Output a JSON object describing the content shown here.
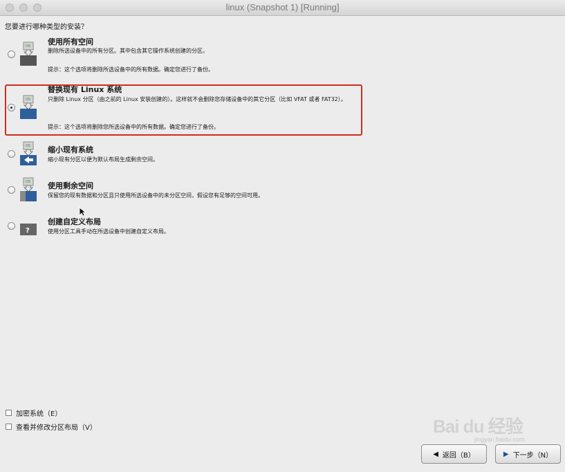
{
  "window": {
    "title": "linux (Snapshot 1) [Running]"
  },
  "question": "您要进行哪种类型的安装？",
  "options": [
    {
      "title": "使用所有空间",
      "desc": "删除所选设备中的所有分区。其中包含其它操作系统创建的分区。",
      "tip": "提示：这个选项将删除所选设备中的所有数据。确定您进行了备份。",
      "icon": "disk-os-icon",
      "selected": false
    },
    {
      "title": "替换现有 Linux 系统",
      "desc": "只删除 Linux 分区（由之前的 Linux 安装创建的）。这样就不会删除您存储设备中的其它分区（比如 VFAT 或者 FAT32）。",
      "tip": "提示：这个选项将删除您所选设备中的所有数据。确定您进行了备份。",
      "icon": "disk-os-icon",
      "selected": true
    },
    {
      "title": "缩小现有系统",
      "desc": "缩小现有分区以便为默认布局生成剩余空间。",
      "icon": "shrink-disk-icon",
      "selected": false
    },
    {
      "title": "使用剩余空间",
      "desc": "保留您的现有数据和分区且只使用所选设备中的未分区空间，假设您有足够的空间可用。",
      "icon": "free-space-disk-icon",
      "selected": false
    },
    {
      "title": "创建自定义布局",
      "desc": "使用分区工具手动在所选设备中创建自定义布局。",
      "icon": "custom-layout-icon",
      "selected": false
    }
  ],
  "checkboxes": [
    {
      "label": "加密系统（E）",
      "checked": false
    },
    {
      "label": "查看并修改分区布局（V）",
      "checked": false
    }
  ],
  "buttons": {
    "back": "返回（B）",
    "next": "下一步（N）"
  },
  "watermark": {
    "text": "Bai du 经验",
    "sub": "jingyan.baidu.com"
  },
  "colors": {
    "highlight_border": "#d22b1f",
    "background": "#ececec"
  }
}
